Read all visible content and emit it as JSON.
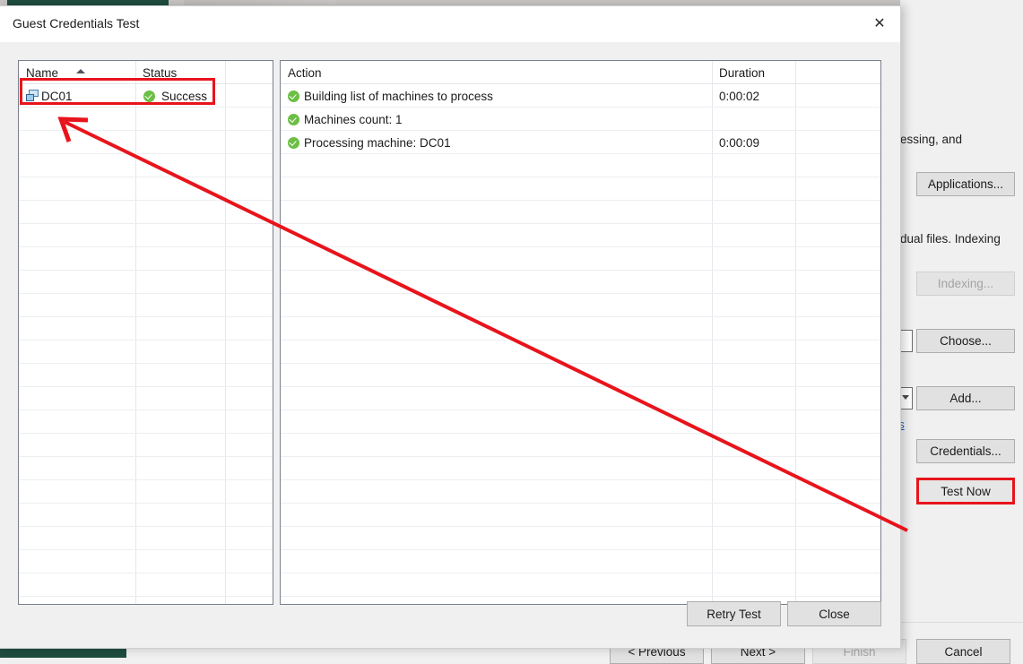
{
  "background": {
    "texts": [
      {
        "id": "frag_processing",
        "value": "essing, and"
      },
      {
        "id": "frag_indexing",
        "value": "dual files. Indexing"
      },
      {
        "id": "frag_link",
        "value": "ts"
      }
    ],
    "buttons": [
      {
        "id": "applications",
        "label": "Applications...",
        "enabled": true
      },
      {
        "id": "indexing",
        "label": "Indexing...",
        "enabled": false
      },
      {
        "id": "choose",
        "label": "Choose...",
        "enabled": true
      },
      {
        "id": "add",
        "label": "Add...",
        "enabled": true
      },
      {
        "id": "credentials",
        "label": "Credentials...",
        "enabled": true
      },
      {
        "id": "test_now",
        "label": "Test Now",
        "enabled": true
      }
    ],
    "wizard_buttons": [
      {
        "id": "previous",
        "label": "< Previous",
        "enabled": true
      },
      {
        "id": "next",
        "label": "Next >",
        "enabled": true
      },
      {
        "id": "finish",
        "label": "Finish",
        "enabled": false
      },
      {
        "id": "cancel",
        "label": "Cancel",
        "enabled": true
      }
    ]
  },
  "dialog": {
    "title": "Guest Credentials Test",
    "close_label": "✕",
    "machines_grid": {
      "columns": [
        "Name",
        "Status",
        ""
      ],
      "sort_column": "Name",
      "sort_direction": "ascending",
      "rows": [
        {
          "name": "DC01",
          "status": "Success",
          "status_icon": "success-check-icon",
          "row_icon": "machine-icon"
        }
      ]
    },
    "actions_grid": {
      "columns": [
        "Action",
        "Duration",
        ""
      ],
      "rows": [
        {
          "icon": "success-check-icon",
          "action": "Building list of machines to process",
          "duration": "0:00:02"
        },
        {
          "icon": "success-check-icon",
          "action": "Machines count: 1",
          "duration": ""
        },
        {
          "icon": "success-check-icon",
          "action": "Processing machine: DC01",
          "duration": "0:00:09"
        }
      ]
    },
    "buttons": [
      {
        "id": "retry_test",
        "label": "Retry Test"
      },
      {
        "id": "close",
        "label": "Close"
      }
    ]
  },
  "toolbar_icons": [
    {
      "id": "list-view-icon"
    },
    {
      "id": "grid-view-icon"
    },
    {
      "id": "document-icon"
    },
    {
      "id": "settings-gear-icon"
    }
  ],
  "annotations": {
    "color": "#e8141c",
    "highlight_row": "DC01 Success",
    "highlight_button": "Test Now",
    "arrow_from": "Test Now",
    "arrow_to": "DC01 row"
  }
}
